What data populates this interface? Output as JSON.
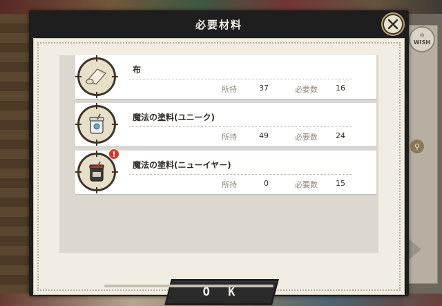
{
  "dialog": {
    "title": "必要材料",
    "ok_label": "O K"
  },
  "side": {
    "wish_label": "WISH"
  },
  "stat_labels": {
    "owned": "所持",
    "required": "必要数"
  },
  "materials": [
    {
      "name": "布",
      "owned": "37",
      "required": "16",
      "icon": "cloth-roll-icon",
      "alert": false
    },
    {
      "name": "魔法の塗料(ユニーク)",
      "owned": "49",
      "required": "24",
      "icon": "paint-jar-icon",
      "alert": false
    },
    {
      "name": "魔法の塗料(ニューイヤー)",
      "owned": "0",
      "required": "15",
      "icon": "paint-jar-dark-icon",
      "alert": true
    }
  ],
  "alert_mark": "!",
  "colors": {
    "dialog_frame": "#1e1e1e",
    "paper": "#f1ede3",
    "row_bg": "#ffffff",
    "alert": "#d23a2a",
    "accent_gold": "#b7a06b"
  }
}
